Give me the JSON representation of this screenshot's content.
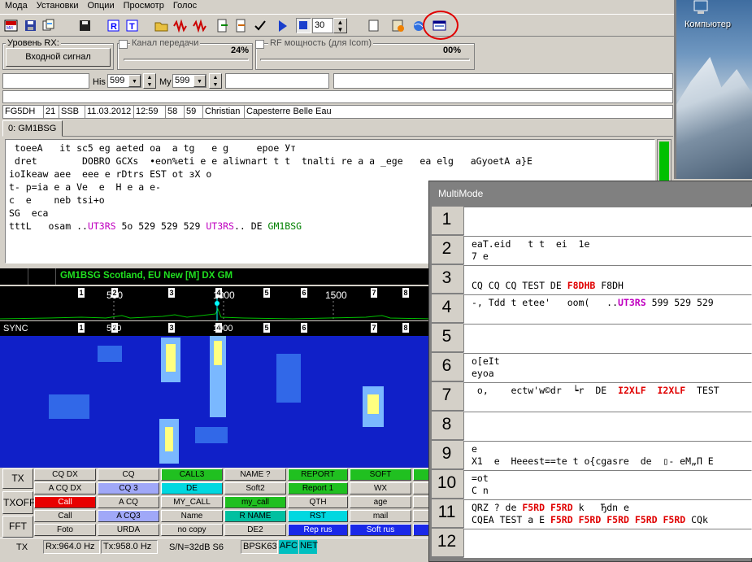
{
  "menu": [
    "Мода",
    "Установки",
    "Опции",
    "Просмотр",
    "Голос"
  ],
  "toolbar": {
    "counter_value": "30"
  },
  "rx_level": {
    "label": "Уровень RX:",
    "button": "Входной сигнал"
  },
  "tx_channel": {
    "label": "Канал передачи",
    "value": "24%"
  },
  "rf_power": {
    "label": "RF мощность (для Icom)",
    "value": "00%"
  },
  "rst": {
    "his_label": "His",
    "his_value": "599",
    "my_label": "My",
    "my_value": "599"
  },
  "log_row": {
    "call": "FG5DH",
    "num": "21",
    "mode": "SSB",
    "date": "11.03.2012",
    "time": "12:59",
    "sent": "58",
    "rcvd": "59",
    "name": "Christian",
    "qth": "Capesterre Belle Eau"
  },
  "rx_tab": "0: GM1BSG",
  "rx_text": {
    "l1": " toeeA   it sc5 eg aeted oa  a tg   e g     epoe Ут",
    "l2": " dret        DOBRO GCXs  •eon%eti e e aliwnart t t  tnalti re a a _ege   ea elg   aGyoetA a}E",
    "l3": "ioIkeaw aee  eee e rDtrs EST ot зX o",
    "l4": "t- p=ia e a Ve  e  H e a e-",
    "l5": "c  e    neb tsi+o",
    "l6": "SG  eca",
    "l7a": "tttL   osam ..",
    "l7b": "UT3RS",
    "l7c": " 5o 529 529 529 ",
    "l7d": "UT3RS",
    ".l7e": "",
    "l7f": ".. DE ",
    "l7g": "GM1BSG"
  },
  "dx_info": "GM1BSG Scotland, EU New [M] DX GM",
  "spectrum": {
    "ticks": [
      "500",
      "1000",
      "1500"
    ],
    "markers": [
      "1",
      "2",
      "3",
      "4",
      "5",
      "6",
      "7",
      "8"
    ],
    "sync_label": "SYNC"
  },
  "side_buttons": [
    "TX",
    "TXOFF",
    "FFT"
  ],
  "macros": [
    [
      "CQ DX",
      "CQ",
      "CALL3",
      "NAME ?",
      "REPORT",
      "SOFT"
    ],
    [
      "A CQ DX",
      "CQ 3",
      "DE",
      "Soft2",
      "Report 1",
      "WX"
    ],
    [
      "Call",
      "A CQ",
      "MY_CALL",
      "my_call",
      "QTH",
      "age"
    ],
    [
      "Call",
      "A CQ3",
      "Name",
      "R NAME",
      "RST",
      "mail"
    ],
    [
      "Foto",
      "URDA",
      "no copy",
      "DE2",
      "Rep rus",
      "Soft rus"
    ]
  ],
  "status": {
    "mode": "TX",
    "rx": "Rx:964.0 Hz",
    "tx": "Tx:958.0 Hz",
    "snr": "S/N=32dB S6",
    "modem": "BPSK63",
    "afc": "AFC",
    "net": "NET"
  },
  "desktop": {
    "icon_label": "Компьютер"
  },
  "multimode": {
    "title": "MultiMode",
    "rows": [
      {
        "n": "1",
        "l1": "",
        "l2": ""
      },
      {
        "n": "2",
        "l1": "eaT.eid   t t  ei  1e",
        "l2": "7 e"
      },
      {
        "n": "3",
        "l1": "",
        "l2": "CQ CQ CQ TEST DE |F8DHB| F8DH"
      },
      {
        "n": "4",
        "l1": "-, Tdd t etee'   oom(   ..|UT3RS| 599 529 529",
        "l2": ""
      },
      {
        "n": "5",
        "l1": "",
        "l2": ""
      },
      {
        "n": "6",
        "l1": "o[eIt",
        "l2": "eyoa"
      },
      {
        "n": "7",
        "l1": " o,    ectw'w©dr  ┕r  DE  |I2XLF|  |I2XLF|  TEST",
        "l2": ""
      },
      {
        "n": "8",
        "l1": "",
        "l2": ""
      },
      {
        "n": "9",
        "l1": "e",
        "l2": "X1  e  Heeest==te t o{cgasre  de  ▯- eM„П E"
      },
      {
        "n": "10",
        "l1": "=ot",
        "l2": "C n"
      },
      {
        "n": "11",
        "l1": "QRZ ? de |F5RD| |F5RD| k   Ђdn e",
        "l2": "CQEA TEST a E |F5RD| |F5RD| |F5RD| |F5RD| |F5RD| CQk"
      },
      {
        "n": "12",
        "l1": "",
        "l2": ""
      }
    ]
  }
}
